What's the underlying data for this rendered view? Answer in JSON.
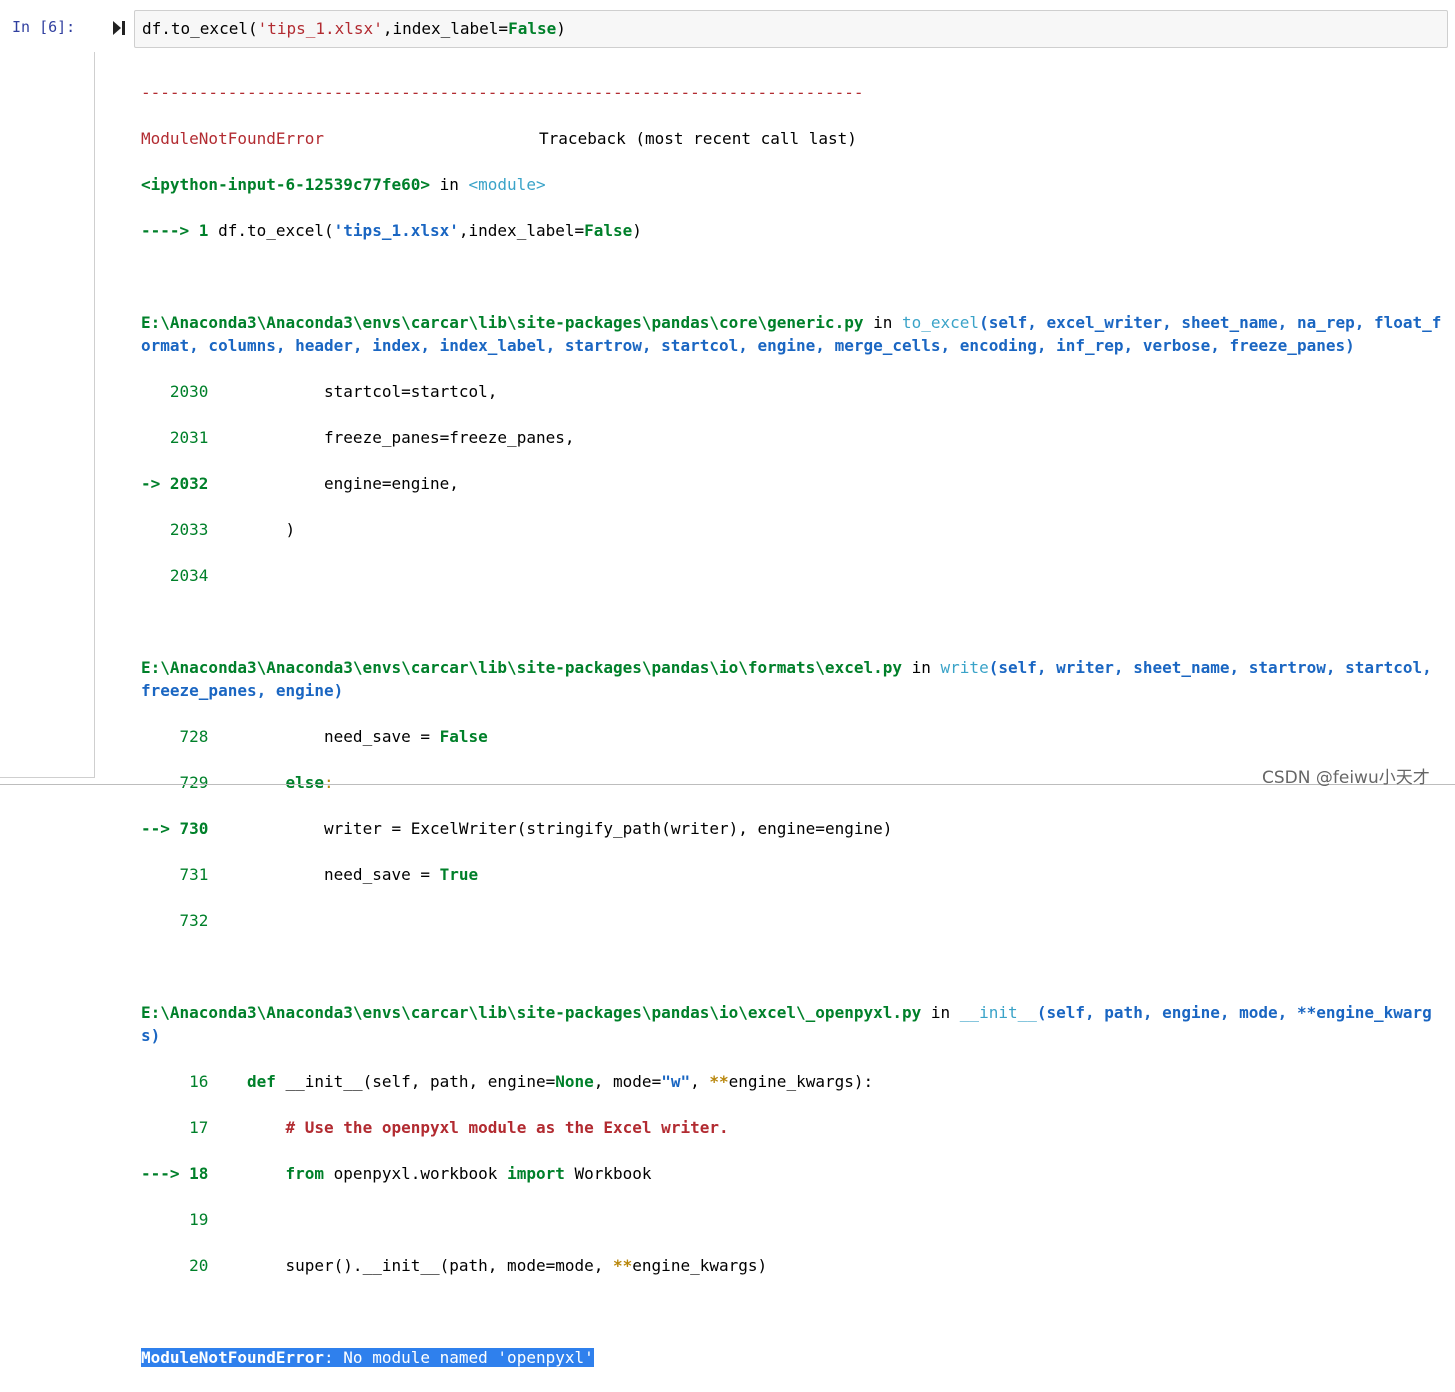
{
  "cell": {
    "prompt": "In  [6]:",
    "code_prefix": "df.to_excel(",
    "code_str": "'tips_1.xlsx'",
    "code_mid": ",index_label=",
    "code_false": "False",
    "code_close": ")"
  },
  "traceback": {
    "separator": "---------------------------------------------------------------------------",
    "error_name": "ModuleNotFoundError",
    "header_right": "Traceback (most recent call last)",
    "input_ref": "<ipython-input-6-12539c77fe60>",
    "in_word": " in ",
    "module_word": "<module>",
    "arrow1": "----> 1 ",
    "line1_code_a": "df.to_excel(",
    "line1_code_str": "'tips_1.xlsx'",
    "line1_code_b": ",index_label=",
    "line1_code_false": "False",
    "line1_code_c": ")",
    "frame1": {
      "path": "E:\\Anaconda3\\Anaconda3\\envs\\carcar\\lib\\site-packages\\pandas\\core\\generic.py",
      "in": " in ",
      "func": "to_excel",
      "args": "(self, excel_writer, sheet_name, na_rep, float_format, columns, header, index, index_label, startrow, startcol, engine, merge_cells, encoding, inf_rep, verbose, freeze_panes)",
      "l1_num": "   2030",
      "l1_code": "            startcol=startcol,",
      "l2_num": "   2031",
      "l2_code": "            freeze_panes=freeze_panes,",
      "l3_arrow": "-> 2032",
      "l3_code": "            engine=engine,",
      "l4_num": "   2033",
      "l4_code": "        )",
      "l5_num": "   2034"
    },
    "frame2": {
      "path": "E:\\Anaconda3\\Anaconda3\\envs\\carcar\\lib\\site-packages\\pandas\\io\\formats\\excel.py",
      "in": " in ",
      "func": "write",
      "args": "(self, writer, sheet_name, startrow, startcol, freeze_panes, engine)",
      "l1_num": "    728",
      "l1_code": "            need_save = ",
      "l1_false": "False",
      "l2_num": "    729",
      "l2_kw": "        else",
      "l2_colon": ":",
      "l3_arrow": "--> 730",
      "l3_code": "            writer = ExcelWriter(stringify_path(writer), engine=engine)",
      "l4_num": "    731",
      "l4_code": "            need_save = ",
      "l4_true": "True",
      "l5_num": "    732"
    },
    "frame3": {
      "path": "E:\\Anaconda3\\Anaconda3\\envs\\carcar\\lib\\site-packages\\pandas\\io\\excel\\_openpyxl.py",
      "in": " in ",
      "func": "__init__",
      "args": "(self, path, engine, mode, **engine_kwargs)",
      "l1_num": "     16",
      "l1_kw": "    def",
      "l1_code_a": " __init__(self, path, engine=",
      "l1_none": "None",
      "l1_code_b": ", mode=",
      "l1_str": "\"w\"",
      "l1_code_c": ", ",
      "l1_stars": "**",
      "l1_code_d": "engine_kwargs):",
      "l2_num": "     17",
      "l2_comment": "        # Use the openpyxl module as the Excel writer.",
      "l3_arrow": "---> 18",
      "l3_kw1": "        from",
      "l3_code_a": " openpyxl.workbook ",
      "l3_kw2": "import",
      "l3_code_b": " Workbook",
      "l4_num": "     19",
      "l5_num": "     20",
      "l5_code_a": "        super().__init__(path, mode=mode, ",
      "l5_stars": "**",
      "l5_code_b": "engine_kwargs)"
    },
    "final_error_name": "ModuleNotFoundError",
    "final_error_msg": ": No module named 'openpyxl'"
  },
  "watermark": "CSDN @feiwu小天才",
  "colors": {
    "prompt": "#303f9f",
    "error_red": "#b22b31",
    "green": "#00802a",
    "blue": "#1a66c2",
    "cyan": "#3aa3c8",
    "highlight": "#2f80ed"
  }
}
